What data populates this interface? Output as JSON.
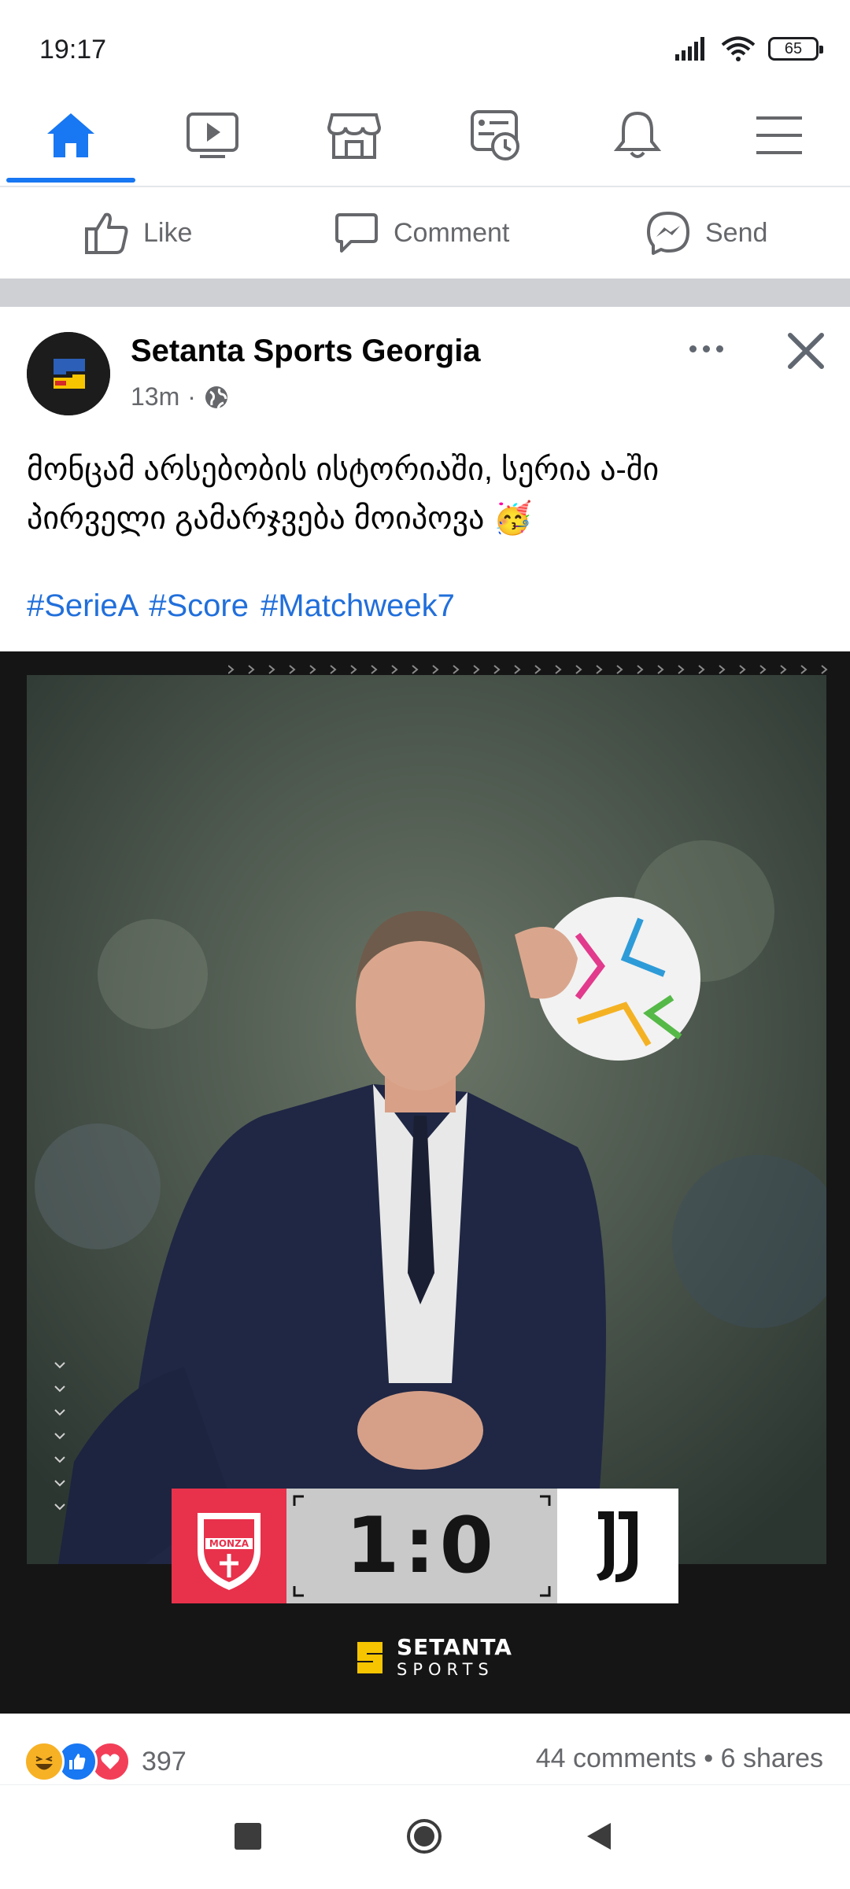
{
  "status_bar": {
    "time": "19:17",
    "battery": "65"
  },
  "nav_tabs": [
    {
      "name": "home",
      "active": true
    },
    {
      "name": "watch",
      "active": false
    },
    {
      "name": "marketplace",
      "active": false
    },
    {
      "name": "feeds",
      "active": false
    },
    {
      "name": "notifications",
      "active": false
    },
    {
      "name": "menu",
      "active": false
    }
  ],
  "actions": {
    "like": "Like",
    "comment": "Comment",
    "send": "Send"
  },
  "post": {
    "page_name": "Setanta Sports Georgia",
    "time": "13m",
    "text_line1": "მონცამ არსებობის ისტორიაში, სერია ა-ში",
    "text_line2": "პირველი გამარჯვება მოიპოვა 🥳",
    "hashtags": "#SerieA #Score #Matchweek7",
    "image": {
      "home_team": "MONZA",
      "score": "1:0",
      "brand_name": "SETANTA",
      "brand_sub": "SPORTS"
    },
    "reactions_count": "397",
    "engagement": "44 comments • 6 shares"
  },
  "colors": {
    "accent": "#1877f2",
    "monza_red": "#e8314b",
    "setanta_yellow": "#f6c500"
  }
}
